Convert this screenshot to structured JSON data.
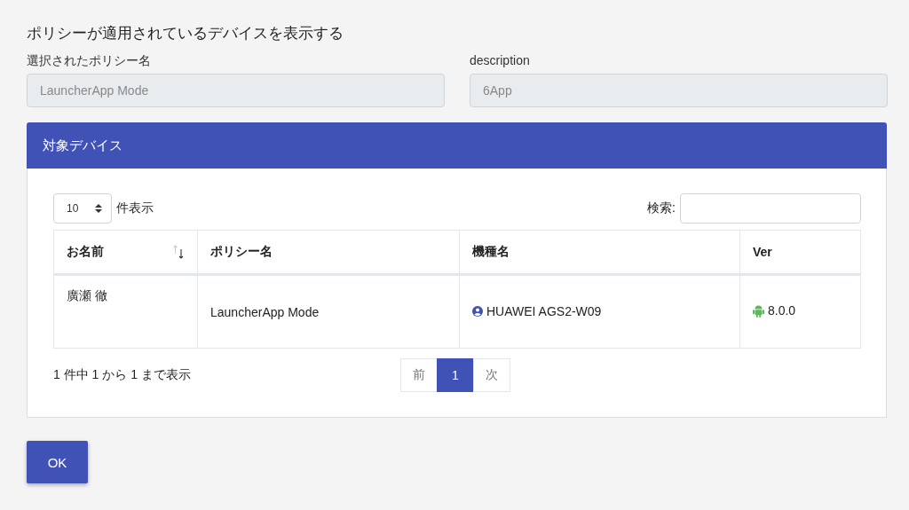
{
  "title": "ポリシーが適用されているデバイスを表示する",
  "fields": [
    {
      "label": "選択されたポリシー名",
      "value": "LauncherApp Mode"
    },
    {
      "label": "description",
      "value": "6App"
    }
  ],
  "card": {
    "title": "対象デバイス",
    "length": {
      "value": "10",
      "suffix": "件表示"
    },
    "search": {
      "label": "検索:"
    },
    "table": {
      "columns": [
        {
          "label": "お名前",
          "sortable": true
        },
        {
          "label": "ポリシー名",
          "sortable": false
        },
        {
          "label": "機種名",
          "sortable": false
        },
        {
          "label": "Ver",
          "sortable": false
        }
      ],
      "rows": [
        {
          "cells": [
            {
              "kind": "text",
              "text": "廣瀬 徹"
            },
            {
              "kind": "text",
              "text": "LauncherApp Mode"
            },
            {
              "kind": "user",
              "text": "HUAWEI AGS2-W09"
            },
            {
              "kind": "android",
              "text": "8.0.0"
            }
          ]
        }
      ]
    },
    "info": "1 件中 1 から 1 まで表示",
    "pagination": [
      {
        "label": "前",
        "selected": false
      },
      {
        "label": "1",
        "selected": true
      },
      {
        "label": "次",
        "selected": false
      }
    ]
  },
  "buttons": [
    "OK"
  ]
}
